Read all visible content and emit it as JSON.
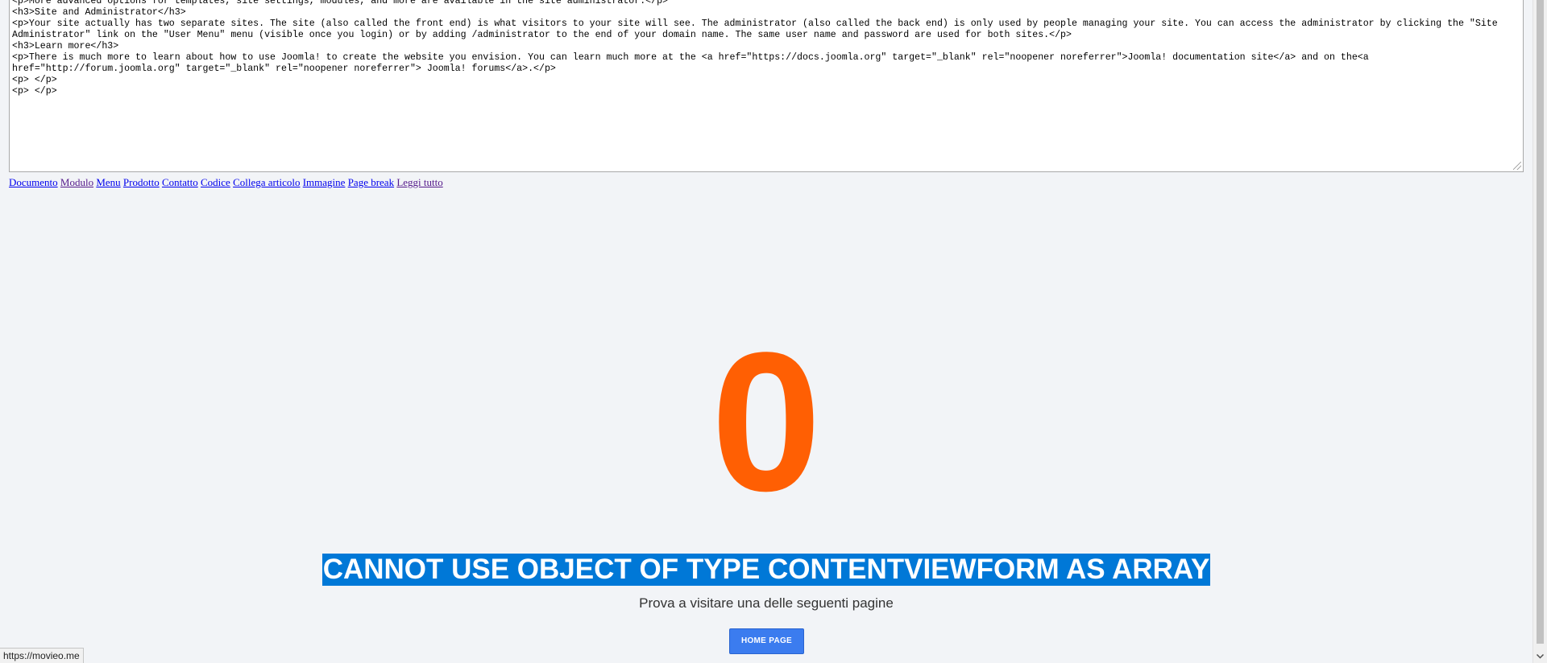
{
  "editor": {
    "lines": [
      "<p>More advanced options for templates, site settings, modules, and more are available in the site administrator.</p>",
      "<h3>Site and Administrator</h3>",
      "<p>Your site actually has two separate sites. The site (also called the front end) is what visitors to your site will see. The administrator (also called the back end) is only used by people managing your site. You can access the administrator by clicking the \"Site Administrator\" link on the \"User Menu\" menu (visible once you login) or by adding /administrator to the end of your domain name. The same user name and password are used for both sites.</p>",
      "<h3>Learn more</h3>",
      "<p>There is much more to learn about how to use Joomla! to create the website you envision. You can learn much more at the <a href=\"https://docs.joomla.org\" target=\"_blank\" rel=\"noopener noreferrer\">Joomla! documentation site</a> and on the<a href=\"http://forum.joomla.org\" target=\"_blank\" rel=\"noopener noreferrer\"> Joomla! forums</a>.</p>",
      "<p> </p>",
      "<p> </p>"
    ]
  },
  "toolbar": {
    "buttons": [
      {
        "label": "Documento",
        "visited": false
      },
      {
        "label": "Modulo",
        "visited": true
      },
      {
        "label": "Menu",
        "visited": false
      },
      {
        "label": "Prodotto",
        "visited": false
      },
      {
        "label": "Contatto",
        "visited": false
      },
      {
        "label": "Codice",
        "visited": false
      },
      {
        "label": "Collega articolo",
        "visited": false
      },
      {
        "label": "Immagine",
        "visited": false
      },
      {
        "label": "Page break",
        "visited": false
      },
      {
        "label": "Leggi tutto",
        "visited": true
      }
    ]
  },
  "error": {
    "code": "0",
    "message": "CANNOT USE OBJECT OF TYPE CONTENTVIEWFORM AS ARRAY",
    "subtitle": "Prova a visitare una delle seguenti pagine",
    "home_button": "HOME PAGE"
  },
  "status_bar": {
    "url": "https://movieo.me"
  },
  "colors": {
    "code": "#ff5f03",
    "selection": "#0078d7",
    "button": "#3b7cef",
    "background": "#f2f4f7"
  },
  "icons": {
    "scroll_down": "chevron-down-icon",
    "resize": "resize-grip-icon"
  }
}
